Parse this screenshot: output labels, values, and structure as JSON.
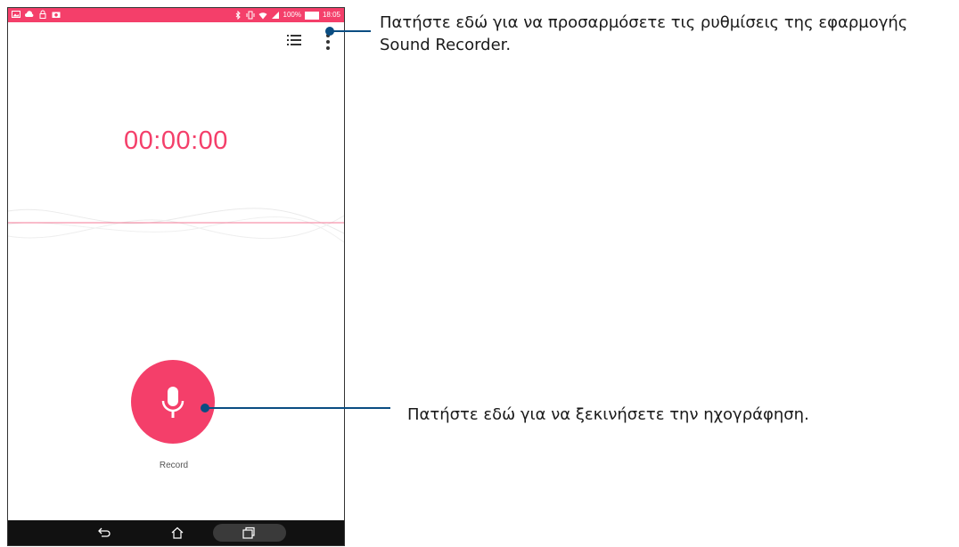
{
  "status_bar": {
    "battery_percent": "100%",
    "time": "18:05",
    "left_icons": [
      "gallery-icon",
      "cloud-icon",
      "lock-icon",
      "camera-icon"
    ],
    "right_icons": [
      "bluetooth-icon",
      "vibrate-icon",
      "wifi-icon",
      "signal-icon",
      "battery-icon"
    ]
  },
  "toolbar": {
    "icons": [
      "list-icon",
      "more-options-icon"
    ]
  },
  "recorder": {
    "timer": "00:00:00",
    "record_label": "Record"
  },
  "callouts": {
    "settings": "Πατήστε εδώ για να προσαρμόσετε τις ρυθμίσεις της εφαρμογής Sound Recorder.",
    "record": "Πατήστε εδώ για να ξεκινήσετε την ηχογράφηση."
  },
  "colors": {
    "accent": "#f43f6a",
    "callout": "#0a4d82",
    "navbar": "#111111"
  }
}
